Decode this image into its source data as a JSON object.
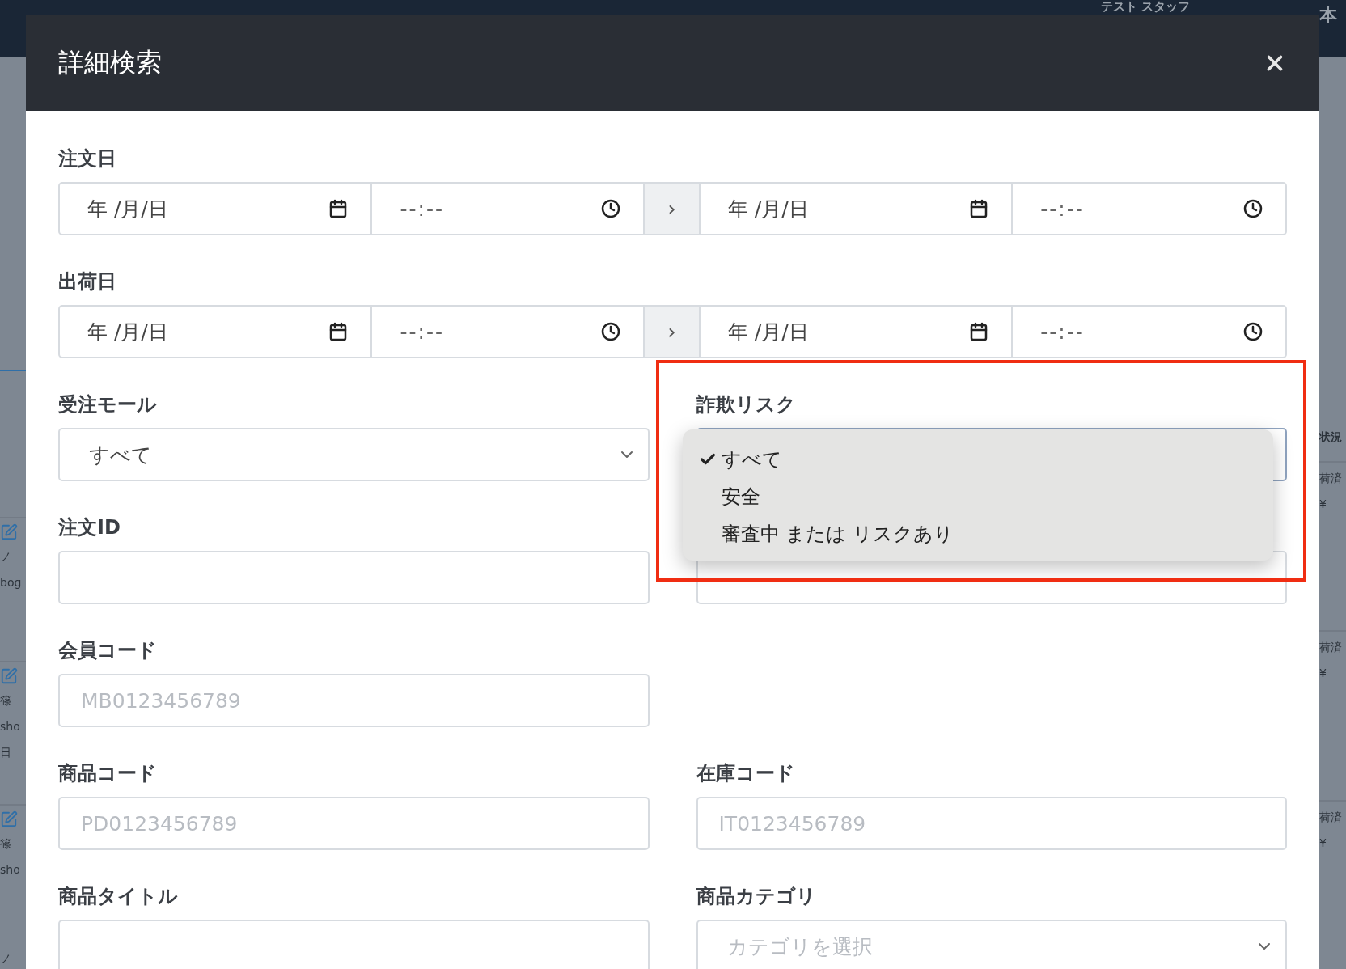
{
  "background": {
    "user_menu": "テスト スタッフ",
    "store": "本",
    "left_rows": [
      {
        "lines": [
          "ノ",
          "bog"
        ]
      },
      {
        "lines": [
          "篠",
          "sho",
          "日"
        ]
      },
      {
        "lines": [
          "篠",
          "sho"
        ]
      }
    ],
    "left_tail": "ノ",
    "right_heading": "状況",
    "right_rows": [
      {
        "lines": [
          "荷済",
          "¥"
        ]
      },
      {
        "lines": [
          "荷済",
          "¥"
        ]
      },
      {
        "lines": [
          "荷済",
          "¥"
        ]
      }
    ]
  },
  "dialog": {
    "title": "詳細検索"
  },
  "date_ranges": [
    {
      "label": "注文日",
      "from_date": "年 /月/日",
      "from_time": "--:--",
      "separator": "›",
      "to_date": "年 /月/日",
      "to_time": "--:--"
    },
    {
      "label": "出荷日",
      "from_date": "年 /月/日",
      "from_time": "--:--",
      "separator": "›",
      "to_date": "年 /月/日",
      "to_time": "--:--"
    }
  ],
  "field_rows": [
    [
      {
        "kind": "select",
        "label": "受注モール",
        "value": "すべて"
      },
      {
        "kind": "select",
        "label": "詐欺リスク",
        "open": true,
        "options": [
          {
            "label": "すべて",
            "selected": true
          },
          {
            "label": "安全",
            "selected": false
          },
          {
            "label": "審査中 または リスクあり",
            "selected": false
          }
        ]
      }
    ],
    [
      {
        "kind": "text",
        "label": "注文ID"
      },
      {
        "kind": "text"
      }
    ],
    [
      {
        "kind": "text",
        "label": "会員コード",
        "placeholder": "MB0123456789"
      }
    ],
    [
      {
        "kind": "text",
        "label": "商品コード",
        "placeholder": "PD0123456789"
      },
      {
        "kind": "text",
        "label": "在庫コード",
        "placeholder": "IT0123456789"
      }
    ],
    [
      {
        "kind": "text",
        "label": "商品タイトル"
      },
      {
        "kind": "select",
        "label": "商品カテゴリ",
        "placeholder": "カテゴリを選択"
      }
    ]
  ]
}
